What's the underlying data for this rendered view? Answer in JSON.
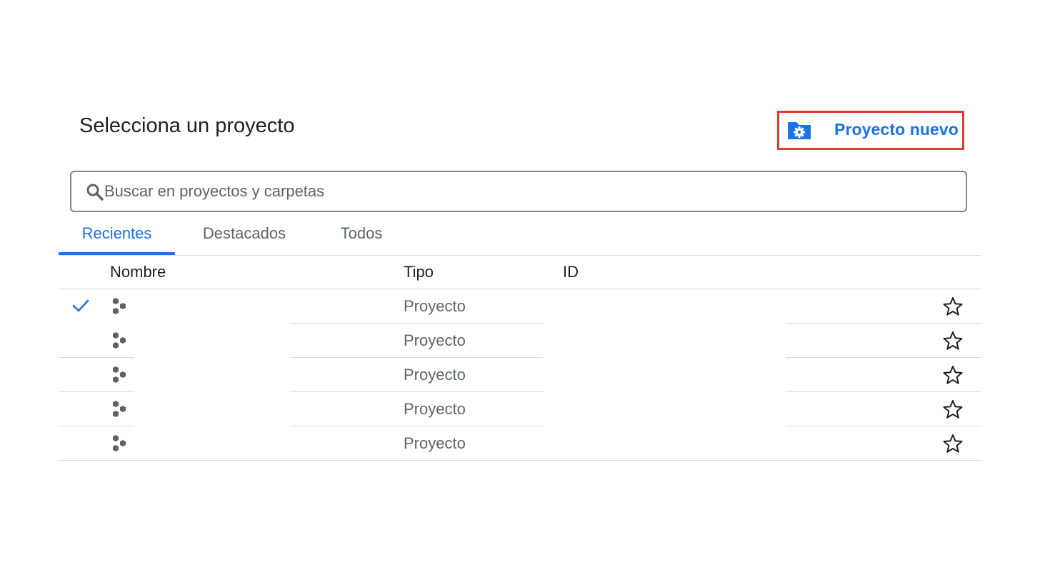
{
  "dialog": {
    "title": "Selecciona un proyecto"
  },
  "new_project": {
    "label": "Proyecto nuevo",
    "icon": "folder-settings-icon"
  },
  "search": {
    "placeholder": "Buscar en proyectos y carpetas",
    "value": "",
    "icon": "search-icon"
  },
  "tabs": [
    {
      "label": "Recientes",
      "active": true
    },
    {
      "label": "Destacados",
      "active": false
    },
    {
      "label": "Todos",
      "active": false
    }
  ],
  "table": {
    "headers": {
      "name": "Nombre",
      "type": "Tipo",
      "id": "ID"
    },
    "rows": [
      {
        "selected": true,
        "name": "",
        "type": "Proyecto",
        "id": "",
        "starred": false
      },
      {
        "selected": false,
        "name": "",
        "type": "Proyecto",
        "id": "",
        "starred": false
      },
      {
        "selected": false,
        "name": "",
        "type": "Proyecto",
        "id": "",
        "starred": false
      },
      {
        "selected": false,
        "name": "",
        "type": "Proyecto",
        "id": "",
        "starred": false
      },
      {
        "selected": false,
        "name": "",
        "type": "Proyecto",
        "id": "",
        "starred": false
      }
    ]
  },
  "colors": {
    "accent": "#1a73e8",
    "highlight_border": "#e53935",
    "icon_grey": "#5f6368",
    "divider": "#dadce0"
  }
}
